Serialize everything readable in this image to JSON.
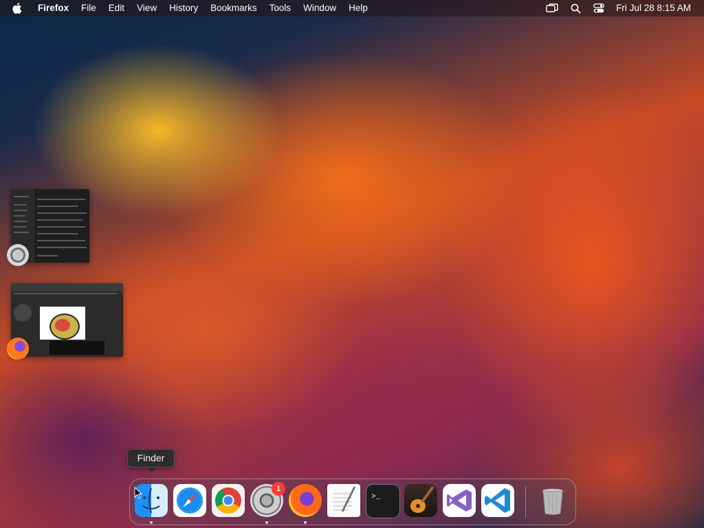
{
  "menubar": {
    "app_name": "Firefox",
    "menus": [
      "File",
      "Edit",
      "View",
      "History",
      "Bookmarks",
      "Tools",
      "Window",
      "Help"
    ],
    "clock": "Fri Jul 28  8:15 AM",
    "status_icons": [
      "screen-mirroring-icon",
      "spotlight-search-icon",
      "control-center-icon"
    ]
  },
  "windows": [
    {
      "app": "System Settings",
      "icon": "system-settings-icon"
    },
    {
      "app": "Firefox",
      "icon": "firefox-icon"
    }
  ],
  "tooltip": {
    "label": "Finder"
  },
  "dock": {
    "items": [
      {
        "name": "Finder",
        "icon": "finder-icon",
        "running": true
      },
      {
        "name": "Safari",
        "icon": "safari-icon",
        "running": false
      },
      {
        "name": "Google Chrome",
        "icon": "chrome-icon",
        "running": false
      },
      {
        "name": "System Settings",
        "icon": "system-settings-icon",
        "running": true,
        "badge": "1"
      },
      {
        "name": "Firefox",
        "icon": "firefox-icon",
        "running": true
      },
      {
        "name": "TextEdit",
        "icon": "textedit-icon",
        "running": false
      },
      {
        "name": "Terminal",
        "icon": "terminal-icon",
        "running": false
      },
      {
        "name": "GarageBand",
        "icon": "garageband-icon",
        "running": false
      },
      {
        "name": "Visual Studio",
        "icon": "visual-studio-icon",
        "running": false
      },
      {
        "name": "Visual Studio Code",
        "icon": "vscode-icon",
        "running": false
      },
      {
        "name": "Trash",
        "icon": "trash-icon",
        "running": false
      }
    ],
    "badge_count": "1"
  },
  "colors": {
    "menubar_bg": "#2a1614",
    "badge_red": "#ff3b30",
    "tooltip_bg": "#2c2c2e"
  }
}
